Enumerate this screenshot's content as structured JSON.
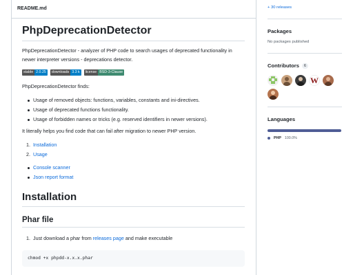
{
  "readme": {
    "filename": "README.md",
    "title": "PhpDeprecationDetector",
    "description": "PhpDeprecationDetector - analyzer of PHP code to search usages of deprecated functionality in newer interpreter versions - deprecations detector.",
    "badges": [
      {
        "label": "stable",
        "value": "2.0.25",
        "color": "#007ec6"
      },
      {
        "label": "downloads",
        "value": "3.3 k",
        "color": "#007ec6"
      },
      {
        "label": "license",
        "value": "BSD-3-Clause",
        "color": "#3e8a70"
      }
    ],
    "finds_intro": "PhpDeprecationDetector finds:",
    "finds": [
      "Usage of removed objects: functions, variables, constants and ini-directives.",
      "Usage of deprecated functions functionality.",
      "Usage of forbidden names or tricks (e.g. reserved identifiers in newer versions)."
    ],
    "help_text": "It literally helps you find code that can fail after migration to newer PHP version.",
    "toc": [
      {
        "num": "1.",
        "label": "Installation"
      },
      {
        "num": "2.",
        "label": "Usage"
      }
    ],
    "extra_links": [
      "Console scanner",
      "Json report format"
    ],
    "installation_heading": "Installation",
    "phar_heading": "Phar file",
    "step_num": "1.",
    "step_prefix": "Just download a phar from",
    "step_link": "releases page",
    "step_suffix": "and make executable",
    "code": "chmod +x phpdd-x.x.x.phar"
  },
  "sidebar": {
    "releases_link": "+ 30 releases",
    "packages_title": "Packages",
    "packages_text": "No packages published",
    "contributors_title": "Contributors",
    "contributors_count": "6",
    "contributors": [
      {
        "icon": "identicon-avatar",
        "color": "#8cc665"
      },
      {
        "icon": "person-avatar",
        "color": "#c9a27e"
      },
      {
        "icon": "person-avatar",
        "color": "#3b3b3b"
      },
      {
        "icon": "letter-w-avatar",
        "letter": "W",
        "color": "#8b1a1a"
      },
      {
        "icon": "person-avatar",
        "color": "#a86b4c"
      },
      {
        "icon": "person-avatar",
        "color": "#b5744e"
      }
    ],
    "languages_title": "Languages",
    "languages": [
      {
        "name": "PHP",
        "percent": "100.0%",
        "color": "#4f5d95"
      }
    ]
  }
}
